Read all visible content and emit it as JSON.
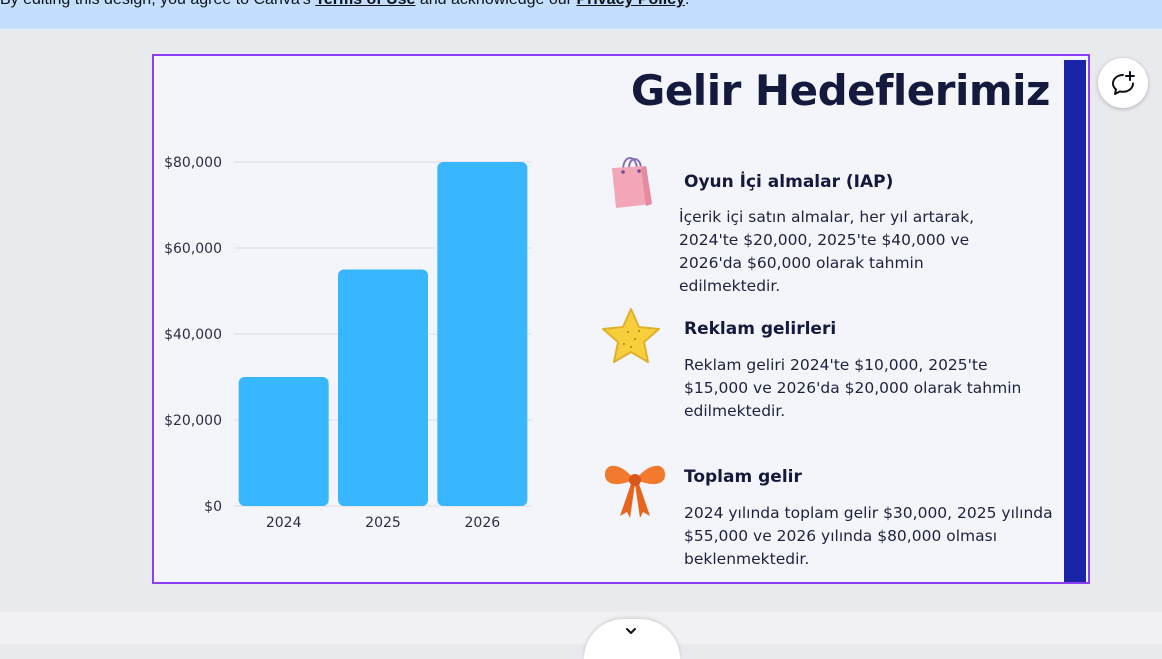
{
  "notice": {
    "prefix": "By editing this design, you agree to Canva's ",
    "terms_link": "Terms of Use",
    "middle": " and acknowledge our ",
    "privacy_link": "Privacy Policy",
    "suffix": "."
  },
  "slide": {
    "title": "Gelir Hedeflerimiz",
    "items": [
      {
        "icon": "shopping-bag-icon",
        "heading": "Oyun İçi almalar (IAP)",
        "body": "İçerik içi satın almalar, her yıl artarak, 2024'te $20,000, 2025'te $40,000 ve 2026'da $60,000 olarak tahmin edilmektedir."
      },
      {
        "icon": "star-icon",
        "heading": "Reklam gelirleri",
        "body": "Reklam geliri 2024'te $10,000, 2025'te $15,000 ve 2026'da $20,000 olarak tahmin edilmektedir."
      },
      {
        "icon": "bow-icon",
        "heading": "Toplam gelir",
        "body": "2024 yılında toplam gelir $30,000, 2025 yılında $55,000 ve 2026 yılında $80,000 olması beklenmektedir."
      }
    ]
  },
  "chart_data": {
    "type": "bar",
    "categories": [
      "2024",
      "2025",
      "2026"
    ],
    "values": [
      30000,
      55000,
      80000
    ],
    "yticks": [
      "$0",
      "$20,000",
      "$40,000",
      "$60,000",
      "$80,000"
    ],
    "ylim": [
      0,
      80000
    ],
    "grid": true,
    "bar_color": "#38b6ff"
  },
  "colors": {
    "accent": "#8b3dff",
    "title": "#141a3d",
    "side_bar": "#1a24a6",
    "notice_bg": "#c4defd"
  },
  "controls": {
    "comment_icon": "add-comment-icon",
    "scroll_icon": "chevron-down-icon"
  }
}
